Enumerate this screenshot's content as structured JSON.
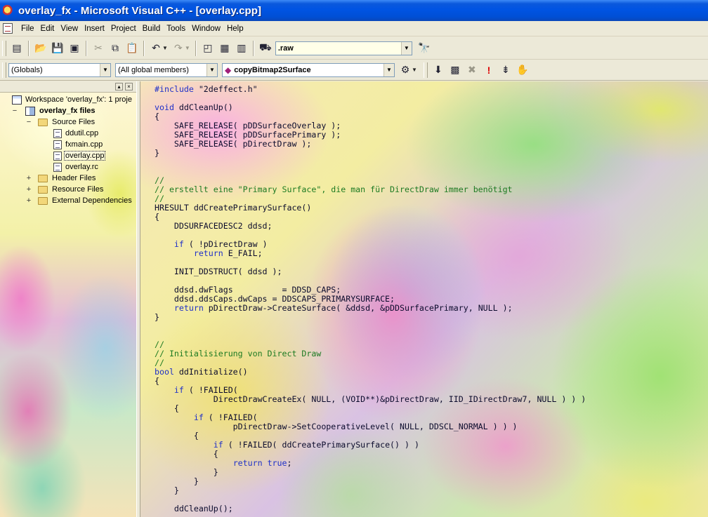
{
  "window": {
    "title": "overlay_fx - Microsoft Visual C++ - [overlay.cpp]"
  },
  "menu": [
    "File",
    "Edit",
    "View",
    "Insert",
    "Project",
    "Build",
    "Tools",
    "Window",
    "Help"
  ],
  "toolbar": {
    "find_value": ".raw"
  },
  "wizardbar": {
    "class_combo": "(Globals)",
    "filter_combo": "(All global members)",
    "members_combo": "copyBitmap2Surface"
  },
  "workspace": {
    "root": "Workspace 'overlay_fx': 1 proje",
    "project": "overlay_fx files",
    "source_folder": "Source Files",
    "source_files": [
      "ddutil.cpp",
      "fxmain.cpp",
      "overlay.cpp",
      "overlay.rc"
    ],
    "header_folder": "Header Files",
    "resource_folder": "Resource Files",
    "external_folder": "External Dependencies",
    "selected_file": "overlay.cpp"
  },
  "editor": {
    "lines": [
      [
        "#include \"2deffect.h\""
      ],
      [
        ""
      ],
      [
        "void ddCleanUp()"
      ],
      [
        "{"
      ],
      [
        "    SAFE_RELEASE( pDDSurfaceOverlay );"
      ],
      [
        "    SAFE_RELEASE( pDDSurfacePrimary );"
      ],
      [
        "    SAFE_RELEASE( pDirectDraw );"
      ],
      [
        "}"
      ],
      [
        ""
      ],
      [
        ""
      ],
      [
        "//"
      ],
      [
        "// erstellt eine \"Primary Surface\", die man für DirectDraw immer benötigt"
      ],
      [
        "//"
      ],
      [
        "HRESULT ddCreatePrimarySurface()"
      ],
      [
        "{"
      ],
      [
        "    DDSURFACEDESC2 ddsd;"
      ],
      [
        ""
      ],
      [
        "    if ( !pDirectDraw )"
      ],
      [
        "        return E_FAIL;"
      ],
      [
        ""
      ],
      [
        "    INIT_DDSTRUCT( ddsd );"
      ],
      [
        ""
      ],
      [
        "    ddsd.dwFlags          = DDSD_CAPS;"
      ],
      [
        "    ddsd.ddsCaps.dwCaps = DDSCAPS_PRIMARYSURFACE;"
      ],
      [
        "    return pDirectDraw->CreateSurface( &ddsd, &pDDSurfacePrimary, NULL );"
      ],
      [
        "}"
      ],
      [
        ""
      ],
      [
        ""
      ],
      [
        "//"
      ],
      [
        "// Initialisierung von Direct Draw"
      ],
      [
        "//"
      ],
      [
        "bool ddInitialize()"
      ],
      [
        "{"
      ],
      [
        "    if ( !FAILED("
      ],
      [
        "            DirectDrawCreateEx( NULL, (VOID**)&pDirectDraw, IID_IDirectDraw7, NULL ) ) )"
      ],
      [
        "    {"
      ],
      [
        "        if ( !FAILED("
      ],
      [
        "                pDirectDraw->SetCooperativeLevel( NULL, DDSCL_NORMAL ) ) )"
      ],
      [
        "        {"
      ],
      [
        "            if ( !FAILED( ddCreatePrimarySurface() ) )"
      ],
      [
        "            {"
      ],
      [
        "                return true;"
      ],
      [
        "            }"
      ],
      [
        "        }"
      ],
      [
        "    }"
      ],
      [
        ""
      ],
      [
        "    ddCleanUp();"
      ]
    ]
  },
  "colors": {
    "keyword": "#1f30c8",
    "comment": "#1d7a22",
    "text": "#0b0b2c",
    "titlebar": "#0054e3"
  },
  "icons": {
    "toolbar1": [
      "workspace-icon",
      "open-folder-icon",
      "save-icon",
      "save-all-icon",
      "cut-icon",
      "copy-icon",
      "paste-icon",
      "undo-icon",
      "redo-icon",
      "workspace-window-icon",
      "output-window-icon",
      "window-list-icon",
      "find-in-files-icon",
      "search-icon"
    ],
    "toolbar2": [
      "wizard-action-icon",
      "compile-icon",
      "build-icon",
      "stop-build-icon",
      "execute-icon",
      "go-icon",
      "breakpoint-icon"
    ]
  }
}
